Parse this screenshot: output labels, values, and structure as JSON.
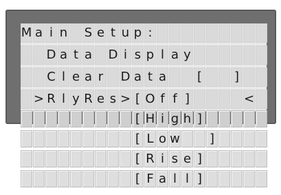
{
  "lcd": {
    "rows": [
      "Main Setup:         ",
      "  Data Display      ",
      "  Clear Data  [  ]  ",
      " >RlyRes>[Off]    < "
    ]
  },
  "dropdown": {
    "options": [
      "[High]",
      "[Low  ]",
      "[Rise]",
      "[Fall]"
    ]
  }
}
